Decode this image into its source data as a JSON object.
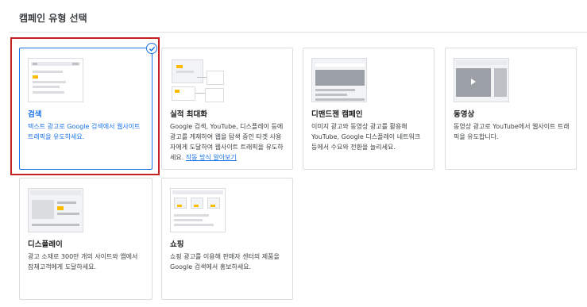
{
  "page": {
    "title": "캠페인 유형 선택"
  },
  "cards": [
    {
      "title": "검색",
      "desc": "텍스트 광고로 Google 검색에서 웹사이트 트래픽을 유도하세요.",
      "selected": true,
      "icon": "search-campaign-illustration"
    },
    {
      "title": "실적 최대화",
      "desc": "Google 검색, YouTube, 디스플레이 등에 광고를 게재하여 웹을 탐색 중인 타겟 사용자에게 도달하여 웹사이트 트래픽을 유도하세요.",
      "link": "작동 방식 알아보기",
      "selected": false,
      "icon": "performance-max-illustration"
    },
    {
      "title": "디맨드젠 캠페인",
      "desc": "이미지 광고와 동영상 광고를 활용해 YouTube, Google 디스플레이 네트워크 등에서 수요와 전환을 늘리세요.",
      "selected": false,
      "icon": "demand-gen-illustration"
    },
    {
      "title": "동영상",
      "desc": "동영상 광고로 YouTube에서 웹사이트 트래픽을 유도합니다.",
      "selected": false,
      "icon": "video-illustration"
    },
    {
      "title": "디스플레이",
      "desc": "광고 소재로 300만 개의 사이트와 앱에서 잠재고객에게 도달하세요.",
      "selected": false,
      "icon": "display-illustration"
    },
    {
      "title": "쇼핑",
      "desc": "쇼핑 광고를 이용해 판매자 센터의 제품을 Google 검색에서 홍보하세요.",
      "selected": false,
      "icon": "shopping-illustration"
    }
  ],
  "colors": {
    "accent": "#1a73e8",
    "highlight_frame": "#c5221f",
    "thumb_yellow": "#fbbc04"
  }
}
